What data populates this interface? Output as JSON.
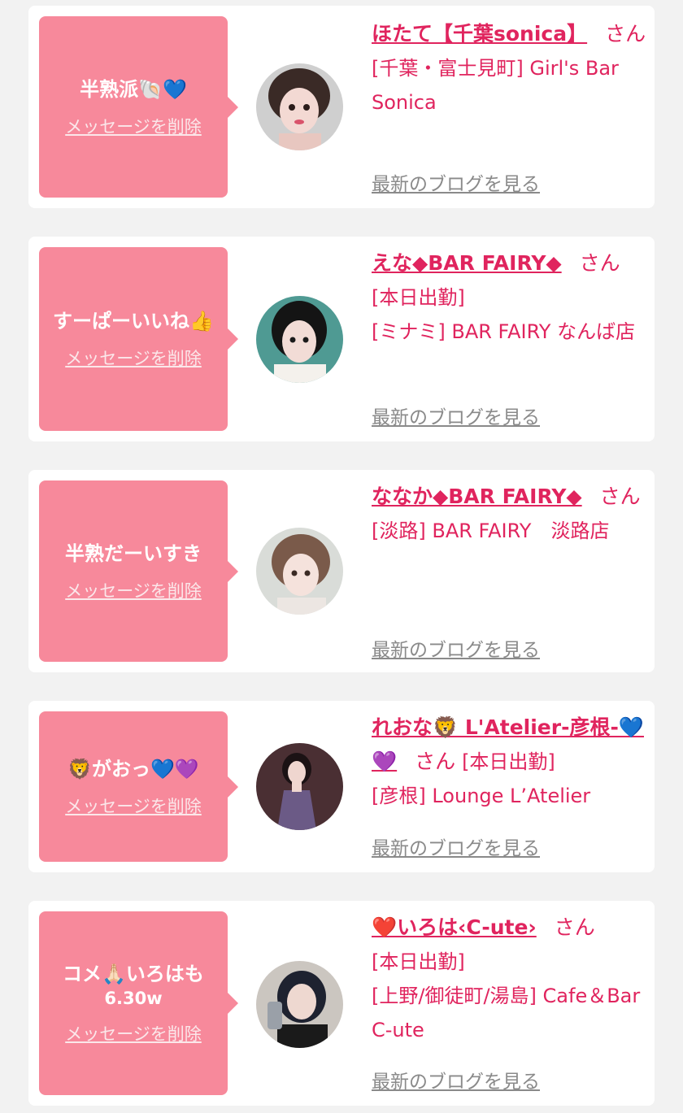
{
  "colors": {
    "bubble_bg": "#f7899b",
    "accent": "#e0245e",
    "muted_link": "#8a8a8a",
    "page_bg": "#f2f2f2",
    "card_bg": "#ffffff"
  },
  "delete_label": "メッセージを削除",
  "blog_label": "最新のブログを見る",
  "san_label": "さん",
  "items": [
    {
      "message": "半熟派🐚💙",
      "message_sub": "",
      "name": "ほたて【千葉sonica】",
      "status": "",
      "shop": "[千葉・富士見町] Girl's Bar Sonica",
      "avatar_icon": "avatar-photo"
    },
    {
      "message": "すーぱーいいね👍",
      "message_sub": "",
      "name": "えな◆BAR FAIRY◆",
      "status": "[本日出勤]",
      "shop": "[ミナミ] BAR FAIRY なんば店",
      "avatar_icon": "avatar-photo"
    },
    {
      "message": "半熟だーいすき",
      "message_sub": "",
      "name": "ななか◆BAR FAIRY◆",
      "status": "",
      "shop": "[淡路] BAR FAIRY　淡路店",
      "avatar_icon": "avatar-photo"
    },
    {
      "message": "🦁がおっ💙💜",
      "message_sub": "",
      "name": "れおな🦁 L'Atelier-彦根-💙💜",
      "status": "[本日出勤]",
      "shop": "[彦根] Lounge L’Atelier",
      "avatar_icon": "avatar-photo"
    },
    {
      "message": "コメ🙏🏻いろはも",
      "message_sub": "6.30w",
      "name": "❤️いろは‹C-ute›",
      "status": "[本日出勤]",
      "shop": "[上野/御徒町/湯島] Cafe＆Bar C-ute",
      "avatar_icon": "avatar-photo"
    }
  ]
}
